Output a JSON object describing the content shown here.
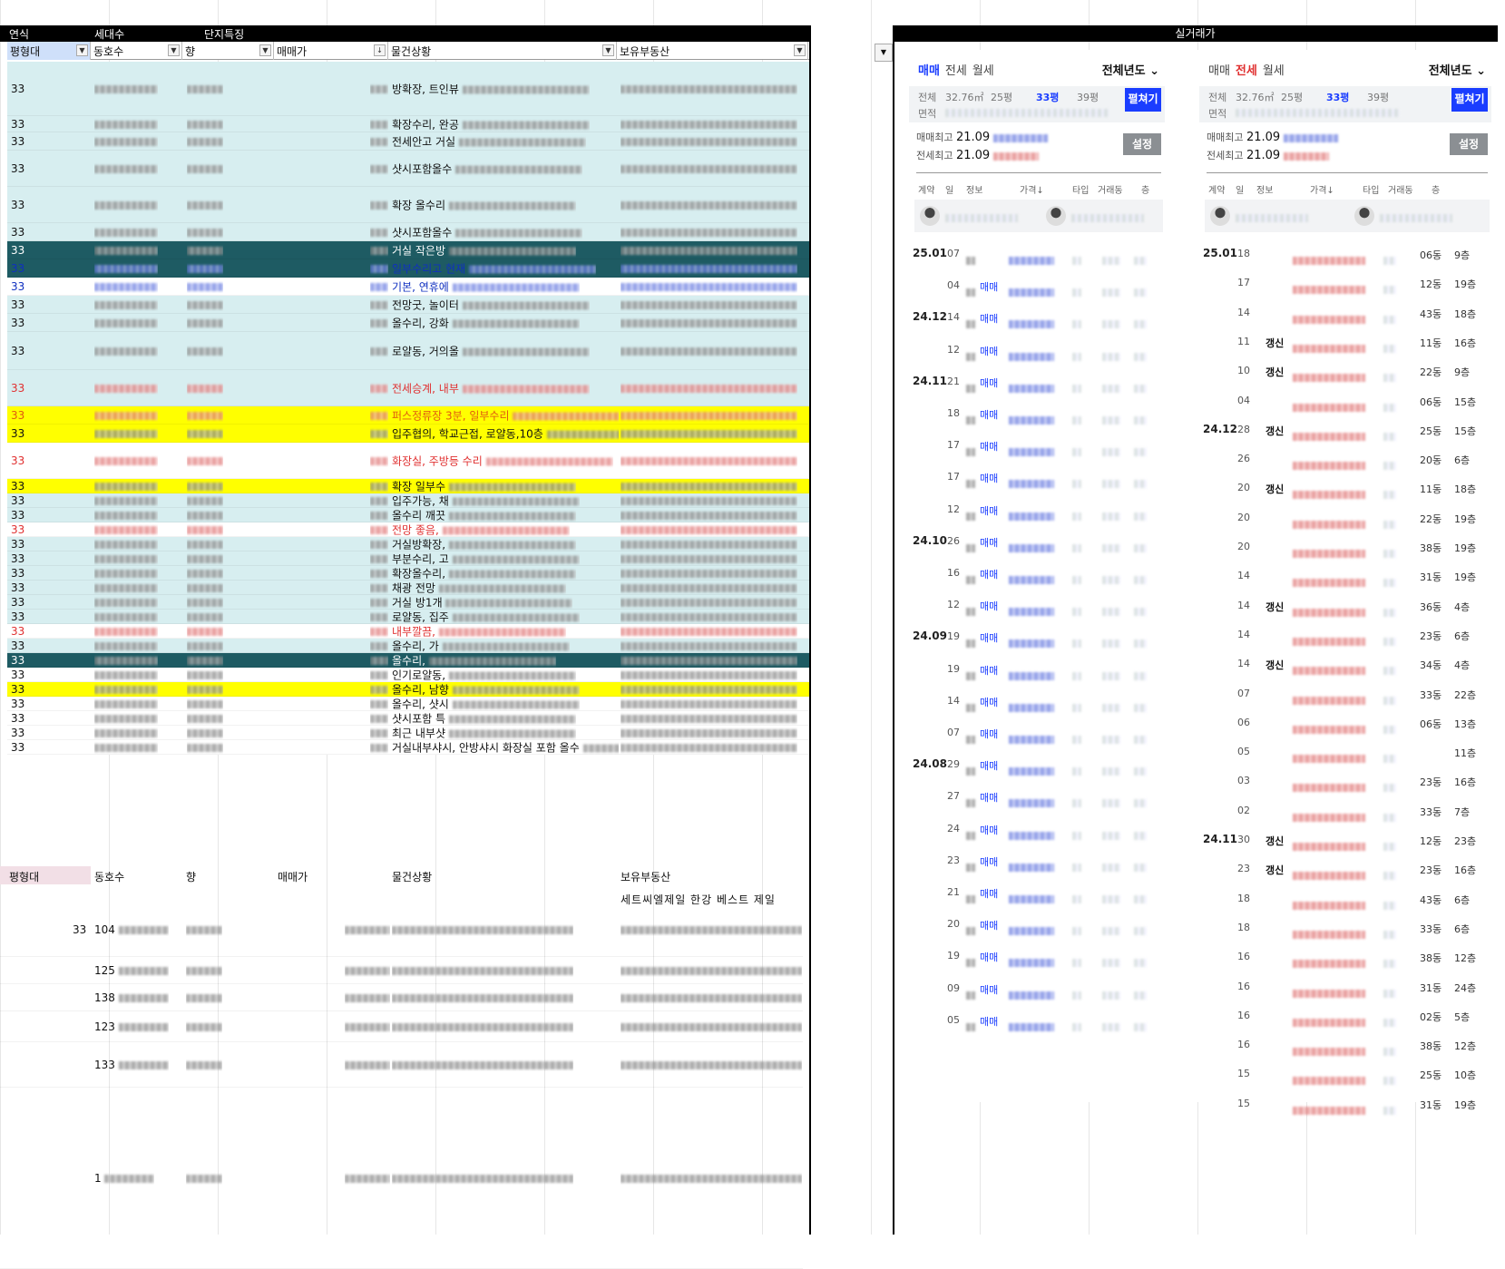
{
  "sheet": {
    "header_labels": {
      "year": "연식",
      "households": "세대수",
      "features": "단지특징"
    },
    "filter_headers": [
      {
        "label": "평형대"
      },
      {
        "label": "동호수"
      },
      {
        "label": "향"
      },
      {
        "label": "매매가"
      },
      {
        "label": "물건상황"
      },
      {
        "label": "보유부동산"
      }
    ],
    "rows": [
      {
        "size": "33",
        "desc": "방확장, 트인뷰",
        "h": 60,
        "bg": "cyan",
        "color": ""
      },
      {
        "size": "33",
        "desc": "확장수리, 완공",
        "h": 18,
        "bg": "cyan",
        "color": ""
      },
      {
        "size": "33",
        "desc": "전세안고 거실",
        "h": 20,
        "bg": "cyan",
        "color": ""
      },
      {
        "size": "33",
        "desc": "샷시포함올수",
        "h": 40,
        "bg": "cyan",
        "color": ""
      },
      {
        "size": "33",
        "desc": "확장 올수리",
        "h": 40,
        "bg": "cyan",
        "color": ""
      },
      {
        "size": "33",
        "desc": "샷시포함올수",
        "h": 20,
        "bg": "cyan",
        "color": ""
      },
      {
        "size": "33",
        "desc": "거실 작은방",
        "h": 20,
        "bg": "teal",
        "color": ""
      },
      {
        "size": "33",
        "desc": "일부수리고 현재",
        "h": 20,
        "bg": "teal",
        "color": "blue"
      },
      {
        "size": "33",
        "desc": "기본, 연휴에",
        "h": 20,
        "bg": "white",
        "color": "blue"
      },
      {
        "size": "33",
        "desc": "전망굿, 놀이터",
        "h": 20,
        "bg": "cyan",
        "color": ""
      },
      {
        "size": "33",
        "desc": "올수리, 강화",
        "h": 20,
        "bg": "cyan",
        "color": ""
      },
      {
        "size": "33",
        "desc": "로얄동, 거의올",
        "h": 42,
        "bg": "cyan",
        "color": ""
      },
      {
        "size": "33",
        "desc": "전세승계, 내부",
        "h": 40,
        "bg": "cyan",
        "color": "red"
      },
      {
        "size": "33",
        "desc": "퍼스정류장 3분, 일부수리",
        "h": 20,
        "bg": "yellow",
        "color": "orange"
      },
      {
        "size": "33",
        "desc": "입주협의, 학교근접, 로얄동,10층",
        "h": 20,
        "bg": "yellow",
        "color": ""
      },
      {
        "size": "33",
        "desc": "화장실, 주방등 수리",
        "h": 40,
        "bg": "white",
        "color": "red"
      },
      {
        "size": "33",
        "desc": "확장 일부수",
        "h": 16,
        "bg": "yellow",
        "color": ""
      },
      {
        "size": "33",
        "desc": "입주가능, 채",
        "h": 16,
        "bg": "cyan",
        "color": ""
      },
      {
        "size": "33",
        "desc": "올수리 깨끗",
        "h": 16,
        "bg": "cyan",
        "color": ""
      },
      {
        "size": "33",
        "desc": "전망 좋음,",
        "h": 16,
        "bg": "white",
        "color": "red"
      },
      {
        "size": "33",
        "desc": "거실방확장,",
        "h": 16,
        "bg": "cyan",
        "color": ""
      },
      {
        "size": "33",
        "desc": "부분수리, 고",
        "h": 16,
        "bg": "cyan",
        "color": ""
      },
      {
        "size": "33",
        "desc": "확장올수리,",
        "h": 16,
        "bg": "cyan",
        "color": ""
      },
      {
        "size": "33",
        "desc": "채광 전망",
        "h": 16,
        "bg": "cyan",
        "color": ""
      },
      {
        "size": "33",
        "desc": "거실 방1개",
        "h": 16,
        "bg": "cyan",
        "color": ""
      },
      {
        "size": "33",
        "desc": "로얄동, 집주",
        "h": 16,
        "bg": "cyan",
        "color": ""
      },
      {
        "size": "33",
        "desc": "내부깔끔,",
        "h": 16,
        "bg": "white",
        "color": "red"
      },
      {
        "size": "33",
        "desc": "올수리, 가",
        "h": 16,
        "bg": "cyan",
        "color": ""
      },
      {
        "size": "33",
        "desc": "올수리,",
        "h": 16,
        "bg": "teal",
        "color": ""
      },
      {
        "size": "33",
        "desc": "인기로얄동,",
        "h": 16,
        "bg": "white",
        "color": ""
      },
      {
        "size": "33",
        "desc": "올수리, 남향",
        "h": 16,
        "bg": "yellow",
        "color": ""
      },
      {
        "size": "33",
        "desc": "올수리, 샷시",
        "h": 16,
        "bg": "white",
        "color": ""
      },
      {
        "size": "33",
        "desc": "샷시포함 특",
        "h": 16,
        "bg": "white",
        "color": ""
      },
      {
        "size": "33",
        "desc": "최근 내부샷",
        "h": 16,
        "bg": "white",
        "color": ""
      },
      {
        "size": "33",
        "desc": "거실내부샤시, 안방샤시 화장실 포함 올수",
        "h": 16,
        "bg": "white",
        "color": ""
      }
    ],
    "bottom_headers": [
      "평형대",
      "동호수",
      "향",
      "매매가",
      "물건상황",
      "보유부동산"
    ],
    "bottom_note": "세트씨엘제일 한강 베스트 제일",
    "bottom_rows": [
      {
        "size": "33",
        "unit": "104",
        "h": 60
      },
      {
        "size": "",
        "unit": "125",
        "h": 30
      },
      {
        "size": "",
        "unit": "138",
        "h": 30
      },
      {
        "size": "",
        "unit": "123",
        "h": 34
      },
      {
        "size": "",
        "unit": "133",
        "h": 50
      },
      {
        "size": "",
        "unit": "1",
        "h": 200
      }
    ]
  },
  "right": {
    "title": "실거래가",
    "panel1": {
      "tabs": [
        "매매",
        "전세",
        "월세"
      ],
      "active_tab": "매매",
      "year": "전체년도",
      "area_labels": [
        "전체",
        "32.76㎡",
        "25평",
        "33평",
        "39평"
      ],
      "area_sub": "면적",
      "selected_area": "33평",
      "btn": "펼쳐기",
      "max_sale": "매매최고",
      "max_sale_date": "21.09",
      "max_rent": "전세최고",
      "max_rent_date": "21.09",
      "settings": "설정",
      "col_headers": [
        "계약",
        "일",
        "정보",
        "가격↓",
        "타입",
        "거래동",
        "층"
      ],
      "rows": [
        {
          "ym": "25.01",
          "d": "07",
          "tag": ""
        },
        {
          "ym": "",
          "d": "04",
          "tag": "매매"
        },
        {
          "ym": "24.12",
          "d": "14",
          "tag": "매매"
        },
        {
          "ym": "",
          "d": "12",
          "tag": "매매"
        },
        {
          "ym": "24.11",
          "d": "21",
          "tag": "매매"
        },
        {
          "ym": "",
          "d": "18",
          "tag": "매매"
        },
        {
          "ym": "",
          "d": "17",
          "tag": "매매"
        },
        {
          "ym": "",
          "d": "17",
          "tag": "매매"
        },
        {
          "ym": "",
          "d": "12",
          "tag": "매매"
        },
        {
          "ym": "24.10",
          "d": "26",
          "tag": "매매"
        },
        {
          "ym": "",
          "d": "16",
          "tag": "매매"
        },
        {
          "ym": "",
          "d": "12",
          "tag": "매매"
        },
        {
          "ym": "24.09",
          "d": "19",
          "tag": "매매"
        },
        {
          "ym": "",
          "d": "19",
          "tag": "매매"
        },
        {
          "ym": "",
          "d": "14",
          "tag": "매매"
        },
        {
          "ym": "",
          "d": "07",
          "tag": "매매"
        },
        {
          "ym": "24.08",
          "d": "29",
          "tag": "매매"
        },
        {
          "ym": "",
          "d": "27",
          "tag": "매매"
        },
        {
          "ym": "",
          "d": "24",
          "tag": "매매"
        },
        {
          "ym": "",
          "d": "23",
          "tag": "매매"
        },
        {
          "ym": "",
          "d": "21",
          "tag": "매매"
        },
        {
          "ym": "",
          "d": "20",
          "tag": "매매"
        },
        {
          "ym": "",
          "d": "19",
          "tag": "매매"
        },
        {
          "ym": "",
          "d": "09",
          "tag": "매매"
        },
        {
          "ym": "",
          "d": "05",
          "tag": "매매"
        }
      ]
    },
    "panel2": {
      "tabs": [
        "매매",
        "전세",
        "월세"
      ],
      "active_tab": "전세",
      "year": "전체년도",
      "area_labels": [
        "전체",
        "32.76㎡",
        "25평",
        "33평",
        "39평"
      ],
      "area_sub": "면적",
      "selected_area": "33평",
      "btn": "펼쳐기",
      "max_sale": "매매최고",
      "max_sale_date": "21.09",
      "max_rent": "전세최고",
      "max_rent_date": "21.09",
      "settings": "설정",
      "col_headers": [
        "계약",
        "일",
        "정보",
        "가격↓",
        "타입",
        "거래동",
        "층"
      ],
      "rows": [
        {
          "ym": "25.01",
          "d": "18",
          "info": "",
          "dong": "06동",
          "floor": "9층"
        },
        {
          "ym": "",
          "d": "17",
          "info": "",
          "dong": "12동",
          "floor": "19층"
        },
        {
          "ym": "",
          "d": "14",
          "info": "",
          "dong": "43동",
          "floor": "18층"
        },
        {
          "ym": "",
          "d": "11",
          "info": "갱신",
          "dong": "11동",
          "floor": "16층"
        },
        {
          "ym": "",
          "d": "10",
          "info": "갱신",
          "dong": "22동",
          "floor": "9층"
        },
        {
          "ym": "",
          "d": "04",
          "info": "",
          "dong": "06동",
          "floor": "15층"
        },
        {
          "ym": "24.12",
          "d": "28",
          "info": "갱신",
          "dong": "25동",
          "floor": "15층"
        },
        {
          "ym": "",
          "d": "26",
          "info": "",
          "dong": "20동",
          "floor": "6층"
        },
        {
          "ym": "",
          "d": "20",
          "info": "갱신",
          "dong": "11동",
          "floor": "18층"
        },
        {
          "ym": "",
          "d": "20",
          "info": "",
          "dong": "22동",
          "floor": "19층"
        },
        {
          "ym": "",
          "d": "20",
          "info": "",
          "dong": "38동",
          "floor": "19층"
        },
        {
          "ym": "",
          "d": "14",
          "info": "",
          "dong": "31동",
          "floor": "19층"
        },
        {
          "ym": "",
          "d": "14",
          "info": "갱신",
          "dong": "36동",
          "floor": "4층"
        },
        {
          "ym": "",
          "d": "14",
          "info": "",
          "dong": "23동",
          "floor": "6층"
        },
        {
          "ym": "",
          "d": "14",
          "info": "갱신",
          "dong": "34동",
          "floor": "4층"
        },
        {
          "ym": "",
          "d": "07",
          "info": "",
          "dong": "33동",
          "floor": "22층"
        },
        {
          "ym": "",
          "d": "06",
          "info": "",
          "dong": "06동",
          "floor": "13층"
        },
        {
          "ym": "",
          "d": "05",
          "info": "",
          "dong": "",
          "floor": "11층"
        },
        {
          "ym": "",
          "d": "03",
          "info": "",
          "dong": "23동",
          "floor": "16층"
        },
        {
          "ym": "",
          "d": "02",
          "info": "",
          "dong": "33동",
          "floor": "7층"
        },
        {
          "ym": "24.11",
          "d": "30",
          "info": "갱신",
          "dong": "12동",
          "floor": "23층"
        },
        {
          "ym": "",
          "d": "23",
          "info": "갱신",
          "dong": "23동",
          "floor": "16층"
        },
        {
          "ym": "",
          "d": "18",
          "info": "",
          "dong": "43동",
          "floor": "6층"
        },
        {
          "ym": "",
          "d": "18",
          "info": "",
          "dong": "33동",
          "floor": "6층"
        },
        {
          "ym": "",
          "d": "16",
          "info": "",
          "dong": "38동",
          "floor": "12층"
        },
        {
          "ym": "",
          "d": "16",
          "info": "",
          "dong": "31동",
          "floor": "24층"
        },
        {
          "ym": "",
          "d": "16",
          "info": "",
          "dong": "02동",
          "floor": "5층"
        },
        {
          "ym": "",
          "d": "16",
          "info": "",
          "dong": "38동",
          "floor": "12층"
        },
        {
          "ym": "",
          "d": "15",
          "info": "",
          "dong": "25동",
          "floor": "10층"
        },
        {
          "ym": "",
          "d": "15",
          "info": "",
          "dong": "31동",
          "floor": "19층"
        }
      ]
    }
  }
}
